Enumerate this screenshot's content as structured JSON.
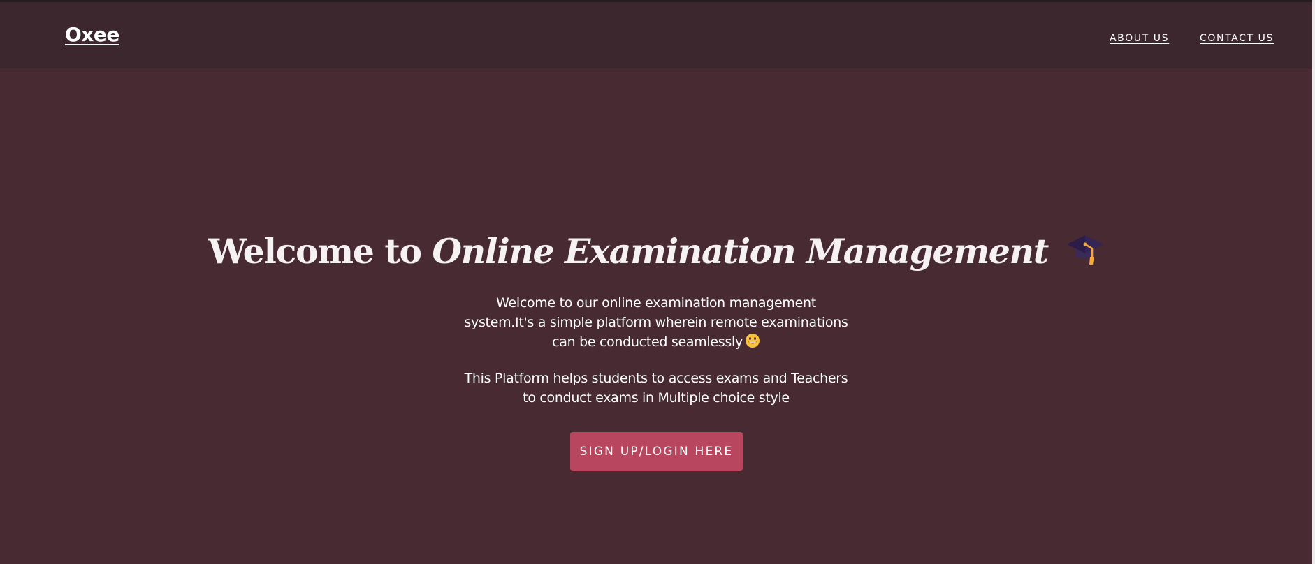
{
  "nav": {
    "brand": "Oxee",
    "links": [
      {
        "label": "ABOUT US"
      },
      {
        "label": "CONTACT US"
      }
    ]
  },
  "hero": {
    "title_prefix": "Welcome to ",
    "title_emphasis": "Online Examination Management",
    "title_icon": "graduation-cap-icon",
    "paragraph1_line1": "Welcome to our online examination management",
    "paragraph1_line2": "system.It's a simple platform wherein remote examinations",
    "paragraph1_line3": "can be conducted seamlessly",
    "paragraph1_icon": "grinning-face-icon",
    "paragraph2_line1": "This Platform helps students to access exams and Teachers",
    "paragraph2_line2": "to conduct exams in Multiple choice style",
    "cta_label": "SIGN UP/LOGIN HERE"
  },
  "colors": {
    "background": "#482a33",
    "header": "#3d272e",
    "cta": "#b9465f",
    "text": "#ffffff"
  }
}
